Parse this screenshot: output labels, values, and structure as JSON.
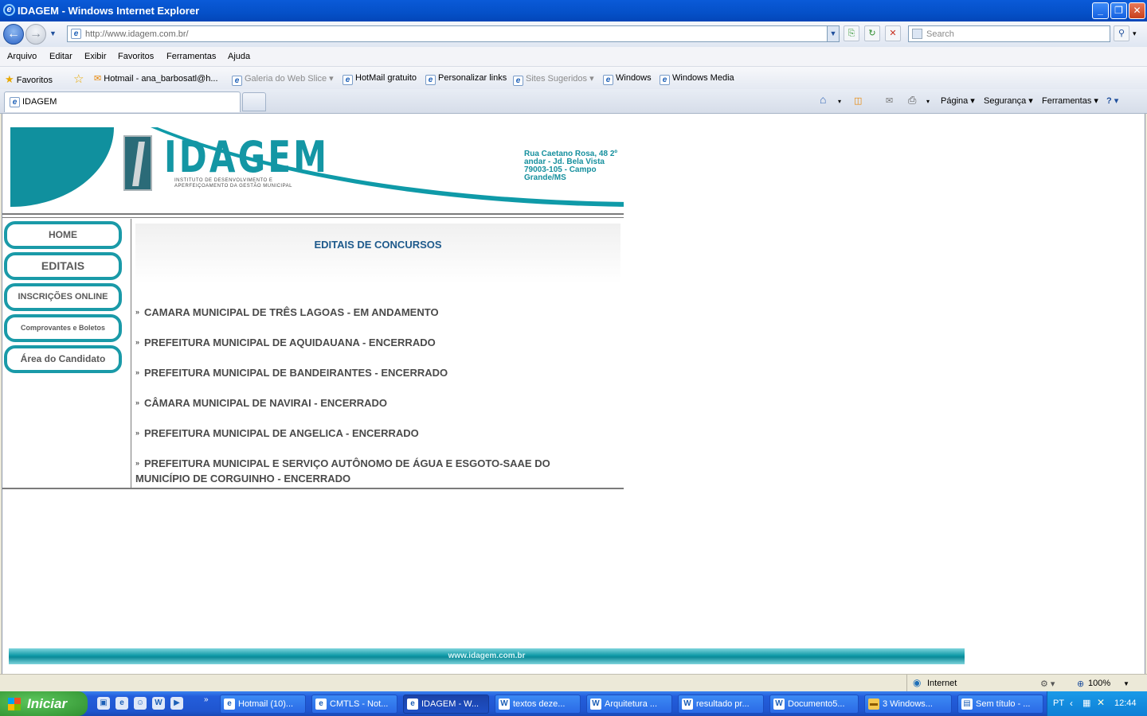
{
  "window": {
    "title": "IDAGEM - Windows Internet Explorer",
    "minimize": "_",
    "maximize": "❐",
    "close": "✕"
  },
  "nav": {
    "url": "http://www.idagem.com.br/",
    "search_placeholder": "Search"
  },
  "menu": [
    "Arquivo",
    "Editar",
    "Exibir",
    "Favoritos",
    "Ferramentas",
    "Ajuda"
  ],
  "favorites": {
    "label": "Favoritos",
    "items": [
      {
        "label": "Hotmail - ana_barbosatl@h..."
      },
      {
        "label": "Galeria do Web Slice ▾"
      },
      {
        "label": "HotMail gratuito"
      },
      {
        "label": "Personalizar links"
      },
      {
        "label": "Sites Sugeridos ▾"
      },
      {
        "label": "Windows"
      },
      {
        "label": "Windows Media"
      }
    ]
  },
  "tab": {
    "title": "IDAGEM"
  },
  "commands": {
    "page": "Página ▾",
    "security": "Segurança ▾",
    "tools": "Ferramentas ▾",
    "help": "? ▾"
  },
  "site": {
    "logo_text": "IDAGEM",
    "logo_subtitle_1": "INSTITUTO DE DESENVOLVIMENTO E",
    "logo_subtitle_2": "APERFEIÇOAMENTO DA GESTÃO MUNICIPAL",
    "address_line1": "Rua Caetano Rosa, 48 2º andar - Jd. Bela Vista",
    "address_line2": "79003-105 - Campo Grande/MS",
    "side_menu": [
      "HOME",
      "EDITAIS",
      "INSCRIÇÕES ONLINE",
      "Comprovantes e Boletos",
      "Área do Candidato"
    ],
    "section_title": "EDITAIS DE CONCURSOS",
    "editais": [
      "CAMARA MUNICIPAL DE TRÊS LAGOAS - EM ANDAMENTO",
      "PREFEITURA MUNICIPAL DE AQUIDAUANA - ENCERRADO",
      "PREFEITURA MUNICIPAL DE BANDEIRANTES - ENCERRADO",
      "CÂMARA MUNICIPAL DE NAVIRAI - ENCERRADO",
      "PREFEITURA MUNICIPAL DE ANGELICA - ENCERRADO",
      "PREFEITURA MUNICIPAL E SERVIÇO AUTÔNOMO DE ÁGUA E ESGOTO-SAAE DO MUNICÍPIO DE CORGUINHO - ENCERRADO"
    ],
    "footer": "www.idagem.com.br"
  },
  "status": {
    "zone": "Internet",
    "zoom": "100%"
  },
  "taskbar": {
    "start": "Iniciar",
    "tasks": [
      "Hotmail (10)...",
      "CMTLS - Not...",
      "IDAGEM - W...",
      "textos deze...",
      "Arquitetura ...",
      "resultado pr...",
      "Documento5...",
      "3 Windows...",
      "Sem título - ..."
    ],
    "lang": "PT",
    "clock": "12:44"
  }
}
